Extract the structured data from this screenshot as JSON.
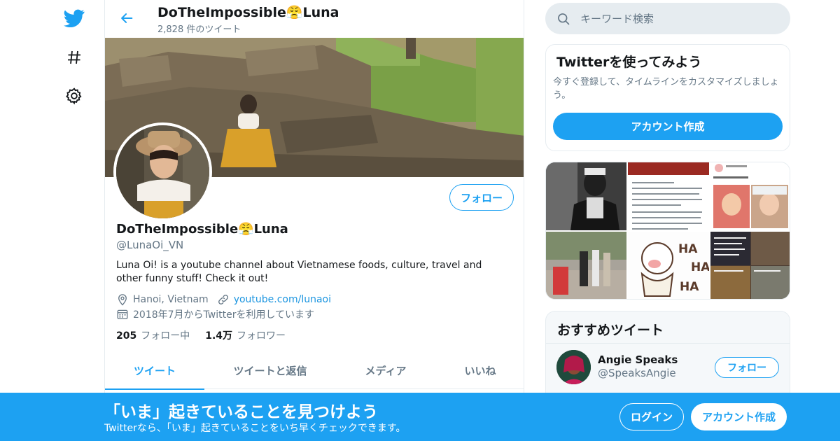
{
  "colors": {
    "brand": "#1da1f2",
    "text_secondary": "#657786",
    "link": "#1b95e0",
    "border": "#e6ecf0"
  },
  "nav": {
    "items": [
      {
        "icon": "twitter-bird-icon"
      },
      {
        "icon": "hashtag-icon"
      },
      {
        "icon": "gear-icon"
      }
    ]
  },
  "header": {
    "name": "DoTheImpossible😤Luna",
    "tweet_count": "2,828 件のツイート"
  },
  "profile": {
    "follow_label": "フォロー",
    "name": "DoTheImpossible😤Luna",
    "handle": "@LunaOi_VN",
    "bio": "Luna Oi! is a youtube channel about Vietnamese foods, culture, travel and other funny stuff! Check it out!",
    "location": "Hanoi, Vietnam",
    "website": "youtube.com/lunaoi",
    "joined": "2018年7月からTwitterを利用しています",
    "following_count": "205",
    "following_label": "フォロー中",
    "followers_count": "1.4万",
    "followers_label": "フォロワー"
  },
  "tabs": [
    {
      "label": "ツイート",
      "active": true
    },
    {
      "label": "ツイートと返信",
      "active": false
    },
    {
      "label": "メディア",
      "active": false
    },
    {
      "label": "いいね",
      "active": false
    }
  ],
  "search": {
    "placeholder": "キーワード検索"
  },
  "signup_card": {
    "title": "Twitterを使ってみよう",
    "description": "今すぐ登録して、タイムラインをカスタマイズしましょう。",
    "button": "アカウント作成"
  },
  "media_grid": {
    "tile_texts": [
      "HA",
      "HA",
      "HA"
    ]
  },
  "recommended": {
    "title": "おすすめツイート",
    "user_name": "Angie Speaks",
    "user_handle": "@SpeaksAngie",
    "follow_label": "フォロー"
  },
  "bottom_bar": {
    "title": "「いま」起きていることを見つけよう",
    "subtitle": "Twitterなら、「いま」起きていることをいち早くチェックできます。",
    "login": "ログイン",
    "signup": "アカウント作成"
  }
}
